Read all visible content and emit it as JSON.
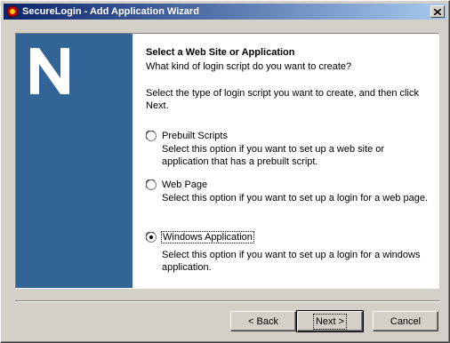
{
  "window": {
    "title": "SecureLogin - Add Application Wizard",
    "icon": "securelogin-app-icon",
    "close_icon": "close-icon"
  },
  "side_panel": {
    "logo_letter": "N",
    "background_color": "#326496"
  },
  "main": {
    "heading": "Select a Web Site or Application",
    "subheading": "What kind of login script do you want to create?",
    "instructions": "Select the type of login script you want to create, and then click Next.",
    "options": [
      {
        "label": "Prebuilt Scripts",
        "description": "Select this option if you want to set up a web site or application that has a prebuilt script.",
        "selected": false
      },
      {
        "label": "Web Page",
        "description": "Select this option if you want to set up a login for a web page.",
        "selected": false
      },
      {
        "label": "Windows Application",
        "description": "Select this option if you want to set up a login for a windows application.",
        "selected": true
      }
    ]
  },
  "buttons": {
    "back": "< Back",
    "next": "Next >",
    "cancel": "Cancel"
  }
}
